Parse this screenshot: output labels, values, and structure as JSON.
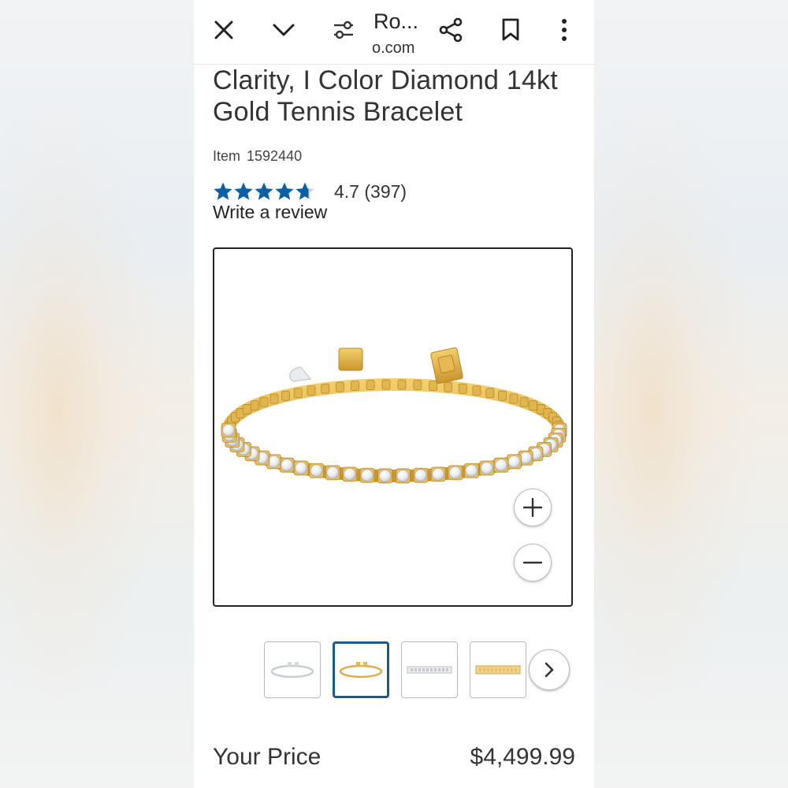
{
  "toolbar": {
    "close_icon": "close-icon",
    "collapse_icon": "chevron-down-icon",
    "site_settings_icon": "tune-icon",
    "url_title": "Ro...",
    "url_domain": "o.com",
    "share_icon": "share-icon",
    "bookmark_icon": "bookmark-icon",
    "menu_icon": "more-vert-icon"
  },
  "product": {
    "title": "Clarity, I Color Diamond 14kt Gold Tennis Bracelet",
    "item_label": "Item",
    "item_number": "1592440",
    "rating": 4.7,
    "rating_value": "4.7",
    "review_count": "(397)",
    "write_review": "Write a review",
    "star_color": "#0b5fa5"
  },
  "gallery": {
    "zoom_in_icon": "plus-icon",
    "zoom_out_icon": "minus-icon",
    "next_icon": "chevron-right-icon",
    "selected_thumbnail": 2,
    "thumbnails": [
      "white-gold-bracelet",
      "yellow-gold-bracelet",
      "white-gold-bracelet-flat",
      "yellow-gold-bracelet-flat"
    ],
    "selected_border_color": "#1d5a8c"
  },
  "pricing": {
    "label": "Your Price",
    "value": "$4,499.99"
  }
}
